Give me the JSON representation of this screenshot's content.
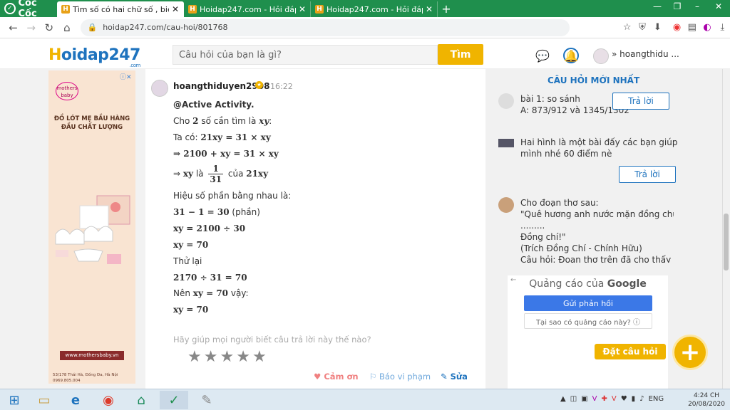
{
  "browser": {
    "brand": "Cốc Cốc",
    "tabs": [
      {
        "title": "Tìm số có hai chữ số , biết rằ",
        "active": true
      },
      {
        "title": "Hoidap247.com - Hỏi đáp on",
        "active": false
      },
      {
        "title": "Hoidap247.com - Hỏi đáp on",
        "active": false
      }
    ],
    "url": "hoidap247.com/cau-hoi/801768"
  },
  "site": {
    "logo_h": "H",
    "logo_rest": "oidap247",
    "logo_domain": ".com",
    "search_placeholder": "Câu hỏi của bạn là gì?",
    "search_button": "Tìm",
    "username": "hoangthidu ..."
  },
  "ad_left": {
    "brand": "mothers baby",
    "headline": "ĐỒ LÓT MẸ BẦU HÀNG ĐẦU CHẤT LƯỢNG",
    "site": "www.mothersbaby.vn",
    "address": "53/178 Thái Hà, Đống Đa, Hà Nội",
    "phone": "0969.805.004"
  },
  "answer": {
    "username": "hoangthiduyen2908",
    "time": "· 16:22",
    "mention": "@Active Activity.",
    "l2_pre": "Cho ",
    "l2_m": "2",
    "l2_mid": " số cần tìm là ",
    "l2_m2": "xy",
    "l2_post": ":",
    "l3_pre": "Ta có: ",
    "l3_m": "21xy = 31 × xy",
    "l4_m": "⇒ 2100 + xy = 31 × xy",
    "l5_pre": "⇒ ",
    "l5_m": "xy",
    "l5_mid": " là ",
    "l5_num": "1",
    "l5_den": "31",
    "l5_mid2": " của ",
    "l5_m2": "21xy",
    "l6": "Hiệu số phần bằng nhau là:",
    "l7_m": "31 − 1 = 30",
    "l7_post": " (phần)",
    "l8_m": "xy = 2100 ÷ 30",
    "l9_m": "xy = 70",
    "l10": "Thử lại",
    "l11_m": "2170 ÷ 31 = 70",
    "l12_pre": "Nên ",
    "l12_m": "xy = 70",
    "l12_post": " vậy:",
    "l13_m": "xy = 70",
    "help_text": "Hãy giúp mọi người biết câu trả lời này thế nào?",
    "rating": 0,
    "thanks": "♥ Cảm ơn",
    "report": "⚐ Báo vi phạm",
    "edit": "✎ Sửa"
  },
  "sidebar": {
    "title": "CÂU HỎI MỚI NHẤT",
    "q1_line1": "bài 1: so sánh",
    "q1_line2": "A: 873/912 và 1345/1302",
    "q2_line1": "Hai hình là một bài đấy các bạn giúp",
    "q2_line2": "mình nhé 60 điểm nè",
    "q3_line1": "Cho đoạn thơ sau:",
    "q3_line2": "\"Quê hương anh nước mặn đồng chua",
    "q3_line3": ".........",
    "q3_line4": "Đồng chí!\"",
    "q3_line5": "(Trích Đồng Chí - Chính Hữu)",
    "q3_line6": "Câu hỏi: Đoạn thơ trên đã cho thấy cơ sở",
    "answer_button": "Trả lời"
  },
  "google_ad": {
    "title_pre": "Quảng cáo của ",
    "title_brand": "Google",
    "send": "Gửi phản hồi",
    "why": "Tại sao có quảng cáo này? ⓘ"
  },
  "ask": {
    "label": "Đặt câu hỏi",
    "plus": "+"
  },
  "taskbar": {
    "lang": "ENG",
    "time": "4:24 CH",
    "date": "20/08/2020"
  },
  "colors": {
    "accent": "#f0b400",
    "brand_blue": "#1e73be",
    "browser_green": "#1f8f4d"
  }
}
